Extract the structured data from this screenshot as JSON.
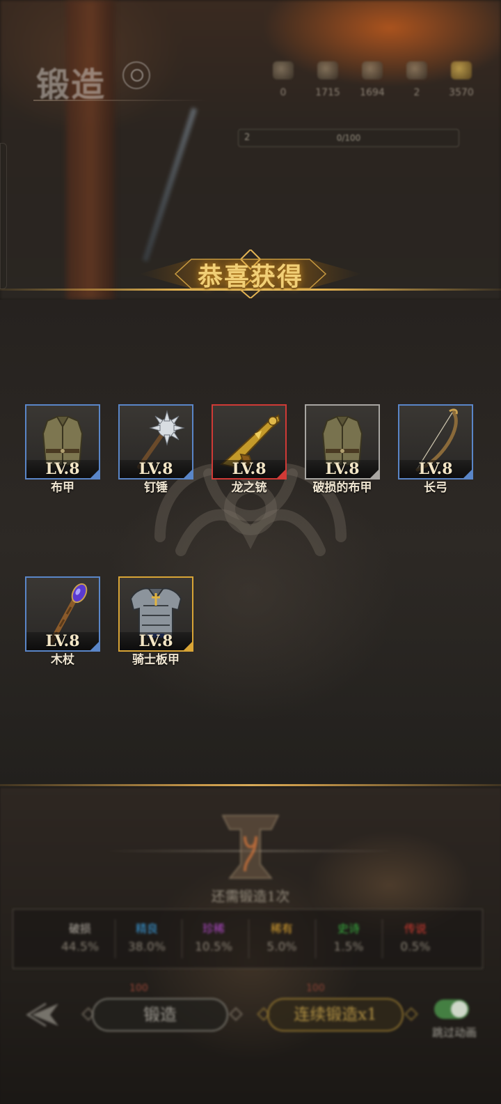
{
  "header": {
    "title": "锻造",
    "resources": [
      {
        "icon": "resource-icon",
        "value": "0"
      },
      {
        "icon": "resource-icon",
        "value": "1715"
      },
      {
        "icon": "resource-icon",
        "value": "1694"
      },
      {
        "icon": "resource-icon",
        "value": "2"
      },
      {
        "icon": "gold-coin-icon",
        "value": "3570"
      }
    ],
    "forge_level": "2",
    "forge_progress": "0/100"
  },
  "banner": {
    "title": "恭喜获得"
  },
  "rewards": [
    {
      "name": "布甲",
      "level": "LV.8",
      "quality": "blue",
      "icon": "cloth-armor-icon"
    },
    {
      "name": "钉锤",
      "level": "LV.8",
      "quality": "blue",
      "icon": "mace-icon"
    },
    {
      "name": "龙之铳",
      "level": "LV.8",
      "quality": "red",
      "icon": "dragon-musket-icon"
    },
    {
      "name": "破损的布甲",
      "level": "LV.8",
      "quality": "gray",
      "icon": "cloth-armor-icon"
    },
    {
      "name": "长弓",
      "level": "LV.8",
      "quality": "blue",
      "icon": "longbow-icon"
    },
    {
      "name": "木杖",
      "level": "LV.8",
      "quality": "blue",
      "icon": "wooden-staff-icon"
    },
    {
      "name": "骑士板甲",
      "level": "LV.8",
      "quality": "gold",
      "icon": "knight-plate-armor-icon"
    }
  ],
  "forge": {
    "count_label": "还需锻造1次",
    "odds": [
      {
        "quality": "破损",
        "percent": "44.5%",
        "color": "#b8b2a8"
      },
      {
        "quality": "精良",
        "percent": "38.0%",
        "color": "#3a9ad8"
      },
      {
        "quality": "珍稀",
        "percent": "10.5%",
        "color": "#b04ac8"
      },
      {
        "quality": "稀有",
        "percent": "5.0%",
        "color": "#d8a030"
      },
      {
        "quality": "史诗",
        "percent": "1.5%",
        "color": "#38b040"
      },
      {
        "quality": "传说",
        "percent": "0.5%",
        "color": "#d03a30"
      }
    ],
    "cost_single": "100",
    "cost_multi": "100",
    "forge_button": "锻造",
    "continuous_button": "连续锻造x1",
    "toggle_label": "跳过动画",
    "toggle_on": true
  },
  "colors": {
    "blue": "#5a86c8",
    "red": "#d03a36",
    "gray": "#a8a6a2",
    "gold": "#d9a536",
    "banner_gold": "#f1cf76"
  }
}
